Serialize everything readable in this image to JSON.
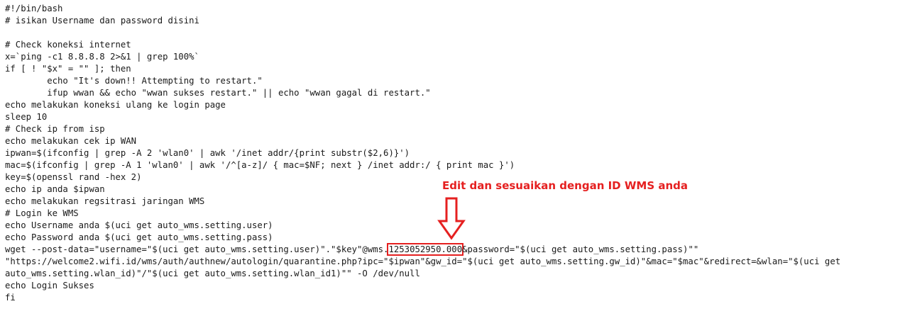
{
  "script_lines": [
    "#!/bin/bash",
    "# isikan Username dan password disini",
    "",
    "# Check koneksi internet",
    "x=`ping -c1 8.8.8.8 2>&1 | grep 100%`",
    "if [ ! \"$x\" = \"\" ]; then",
    "        echo \"It's down!! Attempting to restart.\"",
    "        ifup wwan && echo \"wwan sukses restart.\" || echo \"wwan gagal di restart.\"",
    "echo melakukan koneksi ulang ke login page",
    "sleep 10",
    "# Check ip from isp",
    "echo melakukan cek ip WAN",
    "ipwan=$(ifconfig | grep -A 2 'wlan0' | awk '/inet addr/{print substr($2,6)}')",
    "mac=$(ifconfig | grep -A 1 'wlan0' | awk '/^[a-z]/ { mac=$NF; next } /inet addr:/ { print mac }')",
    "key=$(openssl rand -hex 2)",
    "echo ip anda $ipwan",
    "echo melakukan regsitrasi jaringan WMS",
    "# Login ke WMS",
    "echo Username anda $(uci get auto_wms.setting.user)",
    "echo Password anda $(uci get auto_wms.setting.pass)"
  ],
  "wget_line": {
    "before": "wget --post-data=\"username=\"$(uci get auto_wms.setting.user)\".\"$key\"@wms.",
    "highlight": "1253052950.000",
    "after": "&password=\"$(uci get auto_wms.setting.pass)\"\""
  },
  "script_lines_end": [
    "\"https://welcome2.wifi.id/wms/auth/authnew/autologin/quarantine.php?ipc=\"$ipwan\"&gw_id=\"$(uci get auto_wms.setting.gw_id)\"&mac=\"$mac\"&redirect=&wlan=\"$(uci get",
    "auto_wms.setting.wlan_id)\"/\"$(uci get auto_wms.setting.wlan_id1)\"\" -O /dev/null",
    "echo Login Sukses",
    "fi"
  ],
  "annotation": {
    "text": "Edit dan sesuaikan dengan ID WMS anda",
    "color": "#e52020",
    "icon": "down-arrow-icon"
  }
}
